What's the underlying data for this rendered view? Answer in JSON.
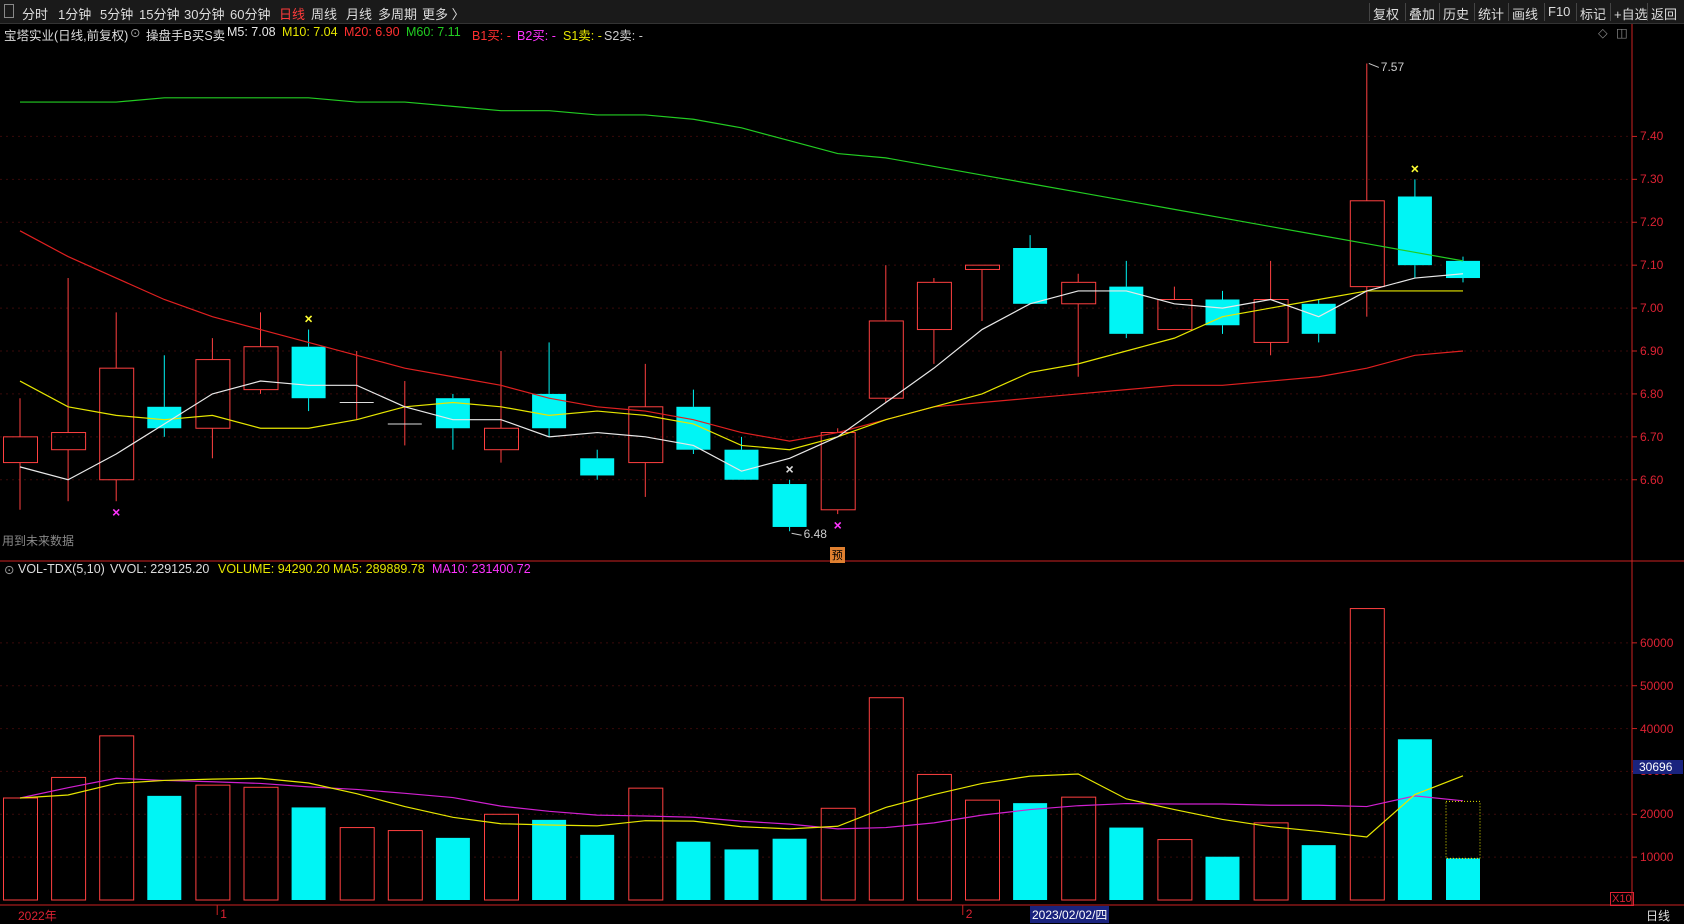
{
  "toolbar": {
    "left_items": [
      "分时",
      "1分钟",
      "5分钟",
      "15分钟",
      "30分钟",
      "60分钟",
      "日线",
      "周线",
      "月线",
      "多周期",
      "更多 〉"
    ],
    "active": "日线",
    "right_items": [
      "复权",
      "叠加",
      "历史",
      "统计",
      "画线",
      "F10",
      "标记",
      "+自选",
      "返回"
    ]
  },
  "info": {
    "stock": "宝塔实业(日线,前复权)",
    "indicator": "操盘手B买S卖",
    "m5": "M5: 7.08",
    "m10": "M10: 7.04",
    "m20": "M20: 6.90",
    "m60": "M60: 7.11",
    "b1": "B1买: -",
    "b2": "B2买: -",
    "s1": "S1卖: -",
    "s2": "S2卖: -",
    "future_note": "用到未来数据",
    "pre_badge": "预"
  },
  "vol_info": {
    "name": "VOL-TDX(5,10)",
    "vvol": "VVOL: 229125.20",
    "volume": "VOLUME: 94290.20",
    "ma5": "MA5: 289889.78",
    "ma10": "MA10: 231400.72"
  },
  "price_axis": [
    "7.40",
    "7.30",
    "7.20",
    "7.10",
    "7.00",
    "6.90",
    "6.80",
    "6.70",
    "6.60"
  ],
  "vol_axis": [
    "60000",
    "50000",
    "40000",
    "30000",
    "20000",
    "10000"
  ],
  "vol_cursor_value": "30696",
  "vol_unit": "X10",
  "bottom_axis": {
    "year": "2022年",
    "m1": "1",
    "m2": "2",
    "cursor_date": "2023/02/02/四",
    "period": "日线"
  },
  "annotations": {
    "high": "7.57",
    "low": "6.48"
  },
  "colors": {
    "up": "#ff4040",
    "down": "#00f5f5",
    "m5": "#e8e8e8",
    "m10": "#e6e600",
    "m20": "#e02020",
    "m60": "#22cc22",
    "vol_ma5": "#e6e600",
    "vol_ma10": "#d020d0",
    "axis": "#cc2222"
  },
  "chart_data": {
    "type": "candlestick",
    "candles": [
      {
        "o": 6.64,
        "c": 6.7,
        "h": 6.79,
        "l": 6.53,
        "v": 23800
      },
      {
        "o": 6.67,
        "c": 6.71,
        "h": 7.07,
        "l": 6.55,
        "v": 28600
      },
      {
        "o": 6.6,
        "c": 6.86,
        "h": 6.99,
        "l": 6.55,
        "v": 38300
      },
      {
        "o": 6.77,
        "c": 6.72,
        "h": 6.89,
        "l": 6.7,
        "v": 24300
      },
      {
        "o": 6.72,
        "c": 6.88,
        "h": 6.93,
        "l": 6.65,
        "v": 26800
      },
      {
        "o": 6.81,
        "c": 6.91,
        "h": 6.99,
        "l": 6.8,
        "v": 26300
      },
      {
        "o": 6.91,
        "c": 6.79,
        "h": 6.95,
        "l": 6.76,
        "v": 21600
      },
      {
        "o": 6.78,
        "c": 6.78,
        "h": 6.9,
        "l": 6.74,
        "v": 16900
      },
      {
        "o": 6.73,
        "c": 6.73,
        "h": 6.83,
        "l": 6.68,
        "v": 16200
      },
      {
        "o": 6.79,
        "c": 6.72,
        "h": 6.8,
        "l": 6.67,
        "v": 14500
      },
      {
        "o": 6.67,
        "c": 6.72,
        "h": 6.9,
        "l": 6.64,
        "v": 20000
      },
      {
        "o": 6.8,
        "c": 6.72,
        "h": 6.92,
        "l": 6.7,
        "v": 18700
      },
      {
        "o": 6.65,
        "c": 6.61,
        "h": 6.67,
        "l": 6.6,
        "v": 15200
      },
      {
        "o": 6.64,
        "c": 6.77,
        "h": 6.87,
        "l": 6.56,
        "v": 26100
      },
      {
        "o": 6.77,
        "c": 6.67,
        "h": 6.81,
        "l": 6.66,
        "v": 13600
      },
      {
        "o": 6.67,
        "c": 6.6,
        "h": 6.7,
        "l": 6.6,
        "v": 11800
      },
      {
        "o": 6.59,
        "c": 6.49,
        "h": 6.6,
        "l": 6.48,
        "v": 14300
      },
      {
        "o": 6.53,
        "c": 6.71,
        "h": 6.72,
        "l": 6.52,
        "v": 21400
      },
      {
        "o": 6.79,
        "c": 6.97,
        "h": 7.1,
        "l": 6.78,
        "v": 47200
      },
      {
        "o": 6.95,
        "c": 7.06,
        "h": 7.07,
        "l": 6.87,
        "v": 29300
      },
      {
        "o": 7.09,
        "c": 7.1,
        "h": 7.1,
        "l": 6.97,
        "v": 23300
      },
      {
        "o": 7.14,
        "c": 7.01,
        "h": 7.17,
        "l": 7.01,
        "v": 22600
      },
      {
        "o": 7.01,
        "c": 7.06,
        "h": 7.08,
        "l": 6.84,
        "v": 24000
      },
      {
        "o": 7.05,
        "c": 6.94,
        "h": 7.11,
        "l": 6.93,
        "v": 16900
      },
      {
        "o": 6.95,
        "c": 7.02,
        "h": 7.05,
        "l": 6.95,
        "v": 14100
      },
      {
        "o": 7.02,
        "c": 6.96,
        "h": 7.04,
        "l": 6.94,
        "v": 10100
      },
      {
        "o": 6.92,
        "c": 7.02,
        "h": 7.11,
        "l": 6.89,
        "v": 18000
      },
      {
        "o": 7.01,
        "c": 6.94,
        "h": 7.02,
        "l": 6.92,
        "v": 12800
      },
      {
        "o": 7.05,
        "c": 7.25,
        "h": 7.57,
        "l": 6.98,
        "v": 68000
      },
      {
        "o": 7.26,
        "c": 7.1,
        "h": 7.3,
        "l": 7.07,
        "v": 37500
      },
      {
        "o": 7.11,
        "c": 7.07,
        "h": 7.12,
        "l": 7.06,
        "v": 9700
      }
    ],
    "ma5": [
      6.63,
      6.6,
      6.66,
      6.73,
      6.8,
      6.83,
      6.82,
      6.82,
      6.77,
      6.74,
      6.74,
      6.7,
      6.71,
      6.7,
      6.68,
      6.62,
      6.65,
      6.7,
      6.78,
      6.86,
      6.95,
      7.01,
      7.04,
      7.04,
      7.01,
      7.0,
      7.02,
      6.98,
      7.04,
      7.07,
      7.08
    ],
    "ma10": [
      6.83,
      6.77,
      6.75,
      6.74,
      6.75,
      6.72,
      6.72,
      6.74,
      6.77,
      6.78,
      6.77,
      6.75,
      6.76,
      6.75,
      6.73,
      6.68,
      6.67,
      6.7,
      6.74,
      6.77,
      6.8,
      6.85,
      6.87,
      6.9,
      6.93,
      6.98,
      7.0,
      7.02,
      7.04,
      7.04,
      7.04
    ],
    "ma20": [
      7.18,
      7.12,
      7.07,
      7.02,
      6.98,
      6.95,
      6.92,
      6.89,
      6.86,
      6.84,
      6.82,
      6.79,
      6.77,
      6.76,
      6.74,
      6.71,
      6.69,
      6.71,
      6.74,
      6.77,
      6.78,
      6.79,
      6.8,
      6.81,
      6.82,
      6.82,
      6.83,
      6.84,
      6.86,
      6.89,
      6.9
    ],
    "ma60": [
      7.48,
      7.48,
      7.48,
      7.49,
      7.49,
      7.49,
      7.49,
      7.48,
      7.48,
      7.47,
      7.46,
      7.46,
      7.45,
      7.45,
      7.44,
      7.42,
      7.39,
      7.36,
      7.35,
      7.33,
      7.31,
      7.29,
      7.27,
      7.25,
      7.23,
      7.21,
      7.19,
      7.17,
      7.15,
      7.13,
      7.11
    ],
    "vol_ma5": [
      23800,
      24500,
      27200,
      27900,
      28200,
      28400,
      27300,
      24800,
      21800,
      19300,
      17800,
      17500,
      17300,
      18500,
      18400,
      17100,
      16600,
      17200,
      21600,
      24600,
      27200,
      28900,
      29400,
      23600,
      21100,
      18800,
      17100,
      16000,
      14700,
      24600,
      28990
    ],
    "vol_ma10": [
      23800,
      26200,
      28400,
      27900,
      27600,
      27200,
      26400,
      25800,
      24900,
      23900,
      21900,
      20700,
      19800,
      19600,
      19300,
      18400,
      17700,
      16600,
      16900,
      18000,
      19800,
      21100,
      22000,
      22500,
      22400,
      22400,
      22100,
      22100,
      21800,
      24300,
      23140
    ],
    "markers": [
      {
        "i": 2,
        "type": "x",
        "color": "#ff33ff",
        "pos": "below"
      },
      {
        "i": 6,
        "type": "x",
        "color": "#ffff33",
        "pos": "above"
      },
      {
        "i": 16,
        "type": "x",
        "color": "#dddddd",
        "pos": "above"
      },
      {
        "i": 17,
        "type": "x",
        "color": "#ff33ff",
        "pos": "below"
      },
      {
        "i": 29,
        "type": "x",
        "color": "#ffff33",
        "pos": "above"
      }
    ],
    "price_range": [
      6.42,
      7.62
    ],
    "vol_range": [
      0,
      70000
    ]
  }
}
